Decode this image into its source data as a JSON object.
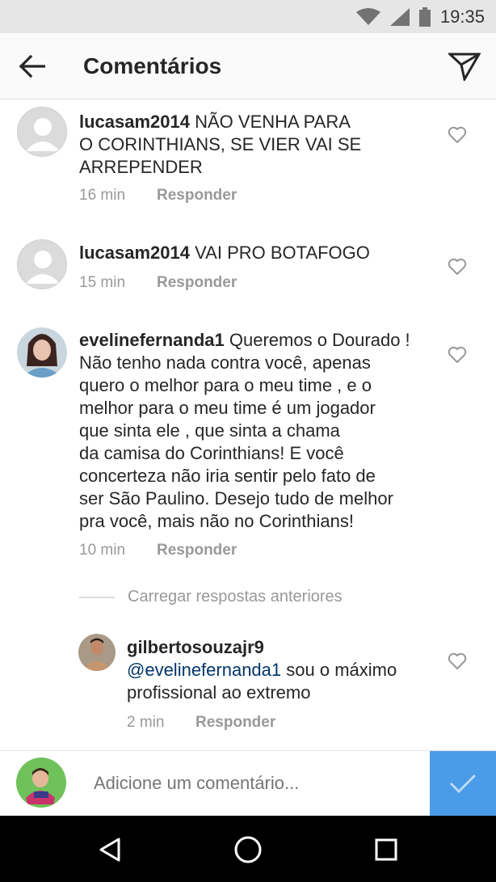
{
  "status_bar": {
    "time": "19:35",
    "icons": [
      "wifi-icon",
      "signal-icon",
      "battery-icon"
    ]
  },
  "header": {
    "title": "Comentários",
    "back_icon": "arrow-left-icon",
    "share_icon": "paper-plane-icon"
  },
  "comments": [
    {
      "username": "lucasam2014",
      "text": "NÃO VENHA PARA O CORINTHIANS, SE VIER VAI SE ARREPENDER",
      "text_lines": [
        "NÃO VENHA PARA",
        "O CORINTHIANS, SE VIER VAI SE",
        "ARREPENDER"
      ],
      "time": "16 min",
      "reply_label": "Responder"
    },
    {
      "username": "lucasam2014",
      "text": "VAI PRO BOTAFOGO",
      "time": "15 min",
      "reply_label": "Responder"
    },
    {
      "username": "evelinefernanda1",
      "text": "Queremos o Dourado ! Não tenho nada contra você, apenas quero o melhor para o meu time , e o melhor para o meu time é um jogador que sinta ele , que sinta a chama da camisa do Corinthians! E você concerteza não iria sentir pelo fato de ser São Paulino. Desejo tudo de melhor pra você, mais não no Corinthians!",
      "text_lines": [
        "Queremos o Dourado !",
        "Não tenho nada contra você, apenas",
        "quero o melhor para o meu time , e o",
        "melhor para o meu time é um jogador",
        "que sinta ele , que sinta a chama",
        "da camisa do Corinthians! E você",
        "concerteza não iria sentir pelo fato de",
        "ser São Paulino. Desejo tudo de melhor",
        "pra você, mais não no Corinthians!"
      ],
      "time": "10 min",
      "reply_label": "Responder"
    }
  ],
  "load_more_label": "Carregar respostas anteriores",
  "reply": {
    "username": "gilbertosouzajr9",
    "mention": "@evelinefernanda1",
    "text_after_mention": "sou o máximo",
    "text_line2": "profissional ao extremo",
    "time": "2 min",
    "reply_label": "Responder"
  },
  "input": {
    "placeholder": "Adicione um comentário...",
    "submit_icon": "check-icon"
  },
  "colors": {
    "submit_button": "#4a9be8",
    "mention": "#003569",
    "meta_text": "#999999",
    "status_bar": "#e6e6e6"
  },
  "nav_bar": {
    "icons": [
      "back-triangle-icon",
      "home-circle-icon",
      "recents-square-icon"
    ]
  }
}
